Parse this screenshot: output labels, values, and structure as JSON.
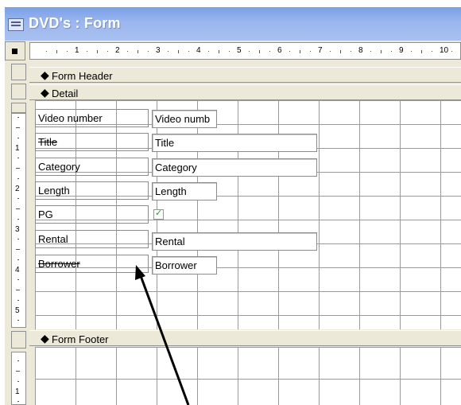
{
  "window": {
    "title": "DVD's : Form"
  },
  "ruler": {
    "horizontal_marks": [
      "1",
      "2",
      "3",
      "4",
      "5",
      "6",
      "7",
      "8",
      "9",
      "10"
    ],
    "vertical_detail_marks": [
      "1",
      "2",
      "3",
      "4",
      "5"
    ],
    "vertical_footer_marks": [
      "1"
    ]
  },
  "sections": {
    "header_label": "Form Header",
    "detail_label": "Detail",
    "footer_label": "Form Footer"
  },
  "fields": [
    {
      "label": "Video number",
      "control": "Video numb",
      "type": "text"
    },
    {
      "label": "Title",
      "control": "Title",
      "type": "text"
    },
    {
      "label": "Category",
      "control": "Category",
      "type": "text"
    },
    {
      "label": "Length",
      "control": "Length",
      "type": "text"
    },
    {
      "label": "PG",
      "control": "",
      "type": "checkbox",
      "checked": true
    },
    {
      "label": "Rental",
      "control": "Rental",
      "type": "text"
    },
    {
      "label": "Borrower",
      "control": "Borrower",
      "type": "text"
    }
  ],
  "icons": {
    "window": "form-window-icon",
    "section": "section-arrow-icon",
    "annotation": "annotation-arrow"
  }
}
